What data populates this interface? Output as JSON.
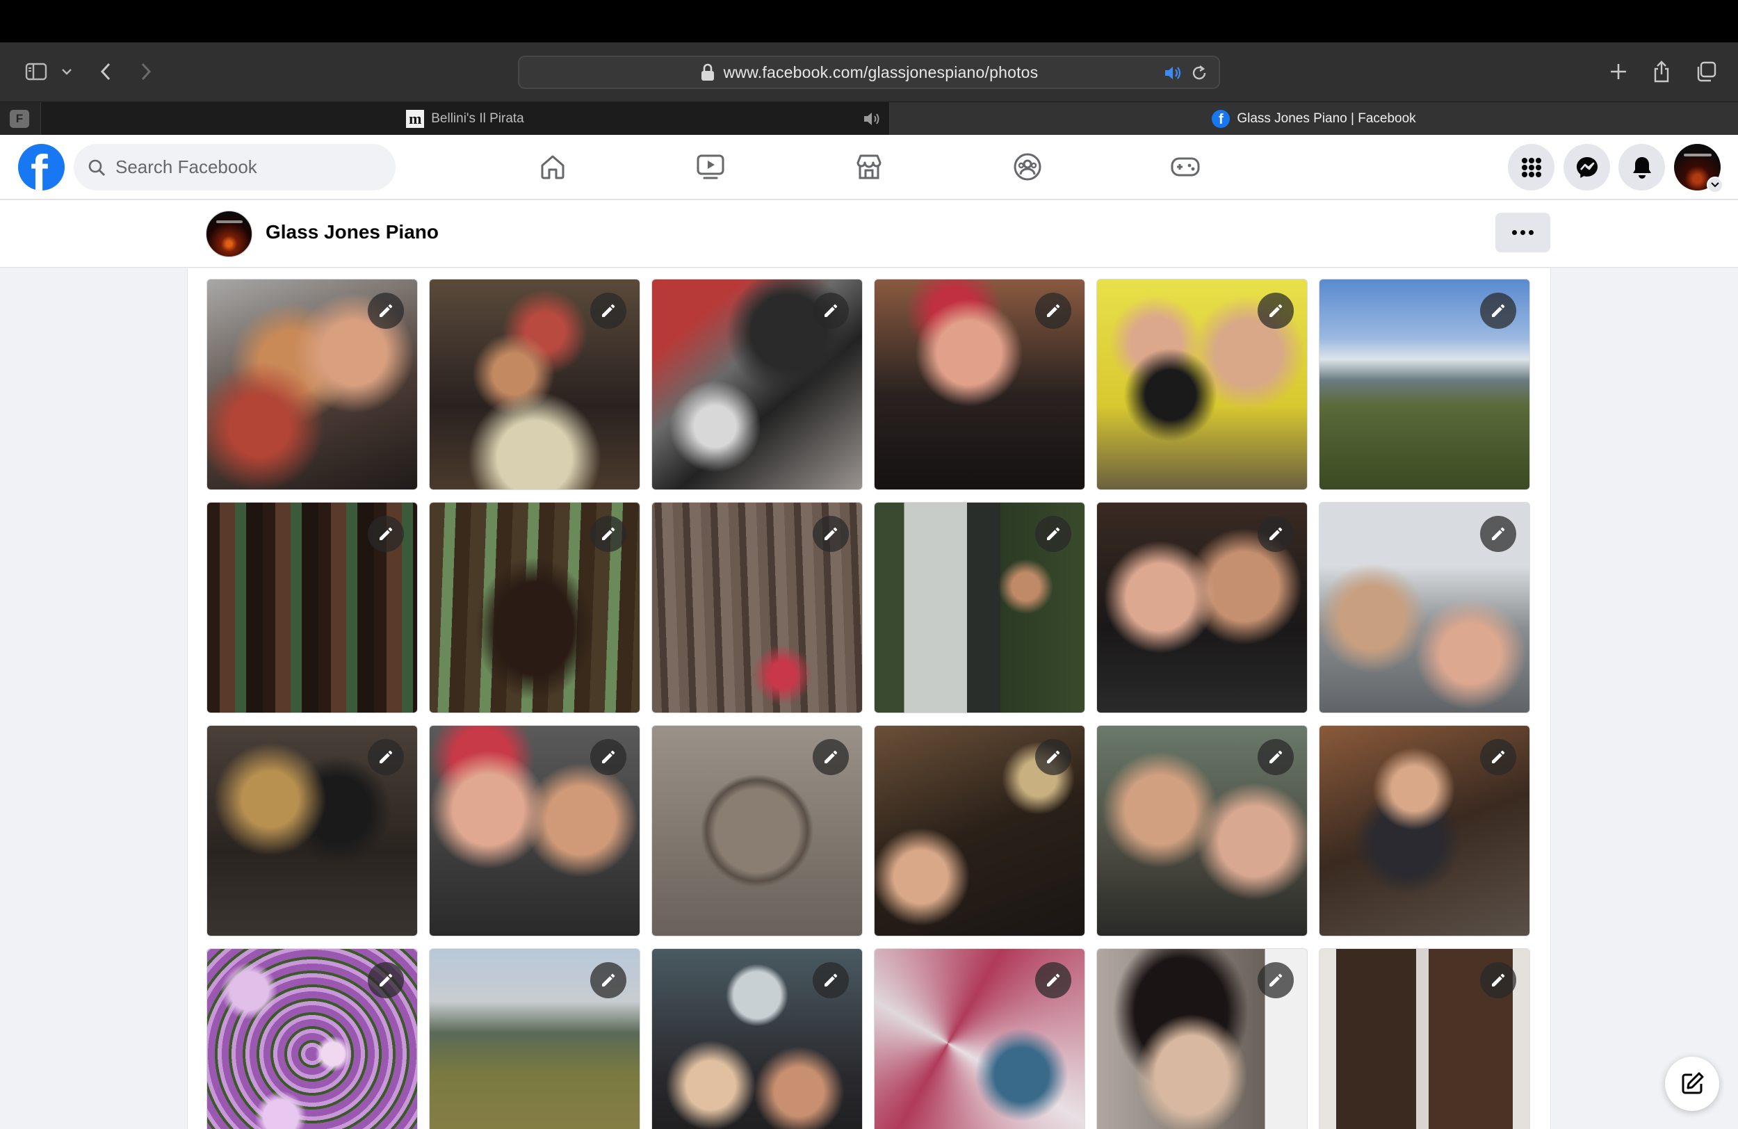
{
  "browser": {
    "url": "www.facebook.com/glassjonespiano/photos",
    "pinned_tab_letter": "F",
    "tabs": [
      {
        "label": "Bellini's Il Pirata",
        "favicon": "m-icon",
        "audio": "muted-speaker-icon",
        "active": false
      },
      {
        "label": "Glass Jones Piano | Facebook",
        "favicon": "facebook-icon",
        "active": true
      }
    ]
  },
  "facebook": {
    "brand_color": "#1877f2",
    "search_placeholder": "Search Facebook",
    "nav_icons": [
      "home-icon",
      "watch-icon",
      "marketplace-icon",
      "groups-icon",
      "gaming-icon"
    ],
    "right_icons": [
      "menu-grid-icon",
      "messenger-icon",
      "notifications-icon",
      "account-avatar"
    ]
  },
  "page": {
    "name": "Glass Jones Piano",
    "more_label": "..."
  },
  "photos": {
    "count_visible": 24,
    "items": [
      "Selfie of a curly-haired woman, a red-haired woman and a man in glasses",
      "Friends at a restaurant table with salads",
      "Tilted selfie with man in cap",
      "Red-haired woman smiling",
      "Man holding black cat beside man in glasses",
      "Bay view from a hilltop",
      "Redwood forest",
      "Large redwood trunks",
      "Woman hugging redwood tree",
      "Man at a phone booth in the woods",
      "Close-up selfie of a couple",
      "Selfie on a city street",
      "Three friends posing indoors",
      "Red-haired woman and man in sunglasses",
      "Framed drawing on a wall",
      "Dim room with people",
      "Selfie of man in sunglasses and woman",
      "Woman at outdoor cafe table",
      "Purple flowers",
      "Mountain landscape",
      "Couple in front of a cafe window",
      "Man next to pink geometric art",
      "Portrait painting of a woman",
      "Dark textured artwork panels"
    ]
  }
}
